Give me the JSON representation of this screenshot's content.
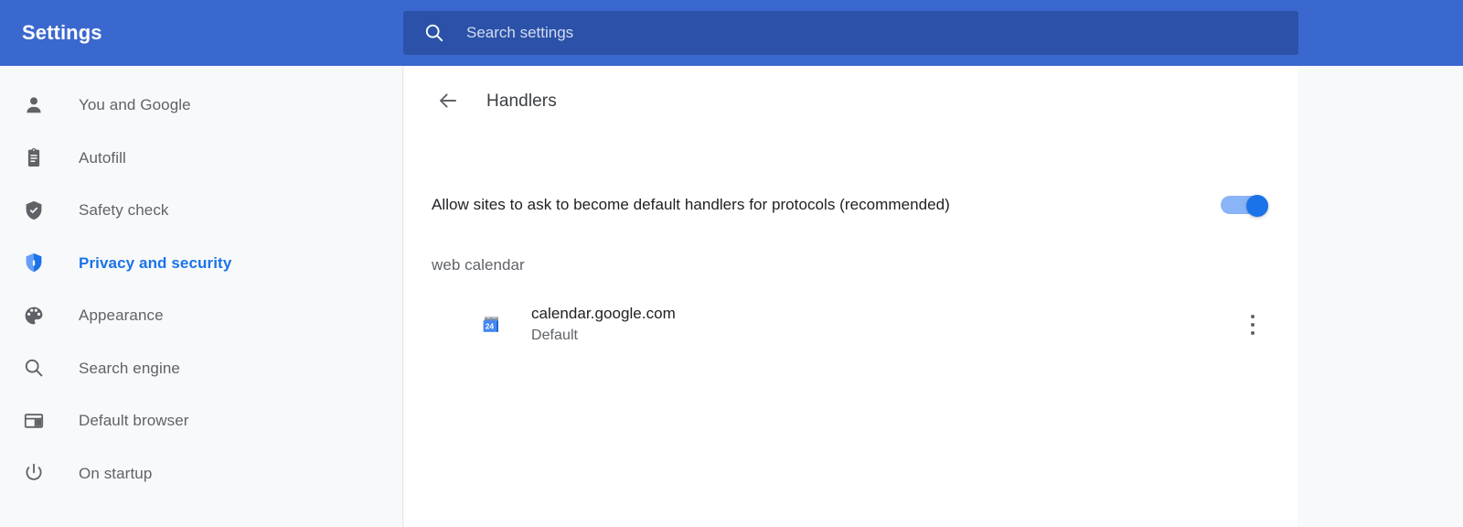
{
  "header": {
    "brand_title": "Settings",
    "search": {
      "placeholder": "Search settings",
      "value": "",
      "icon": "search-icon"
    },
    "background_color": "#3b68ce",
    "search_background_color": "#2b52a8"
  },
  "sidebar": {
    "background_color": "#f8f9fa",
    "active_color": "#1a73e8",
    "text_color": "#5f6368",
    "items": [
      {
        "label": "You and Google",
        "icon": "person-icon",
        "active": false
      },
      {
        "label": "Autofill",
        "icon": "clipboard-icon",
        "active": false
      },
      {
        "label": "Safety check",
        "icon": "shield-check-icon",
        "active": false
      },
      {
        "label": "Privacy and security",
        "icon": "shield-icon",
        "active": true
      },
      {
        "label": "Appearance",
        "icon": "palette-icon",
        "active": false
      },
      {
        "label": "Search engine",
        "icon": "search-icon",
        "active": false
      },
      {
        "label": "Default browser",
        "icon": "browser-window-icon",
        "active": false
      },
      {
        "label": "On startup",
        "icon": "power-icon",
        "active": false
      }
    ]
  },
  "main": {
    "back_icon": "arrow-left-icon",
    "page_title": "Handlers",
    "allow_setting": {
      "label": "Allow sites to ask to become default handlers for protocols (recommended)",
      "toggle_on": true,
      "toggle_track_color": "#8ab4f8",
      "toggle_knob_color": "#1a73e8"
    },
    "protocol_label": "web calendar",
    "handlers": [
      {
        "site": "calendar.google.com",
        "status": "Default",
        "favicon": "google-calendar-icon",
        "favicon_day": "24",
        "menu_icon": "more-vertical-icon"
      }
    ]
  }
}
